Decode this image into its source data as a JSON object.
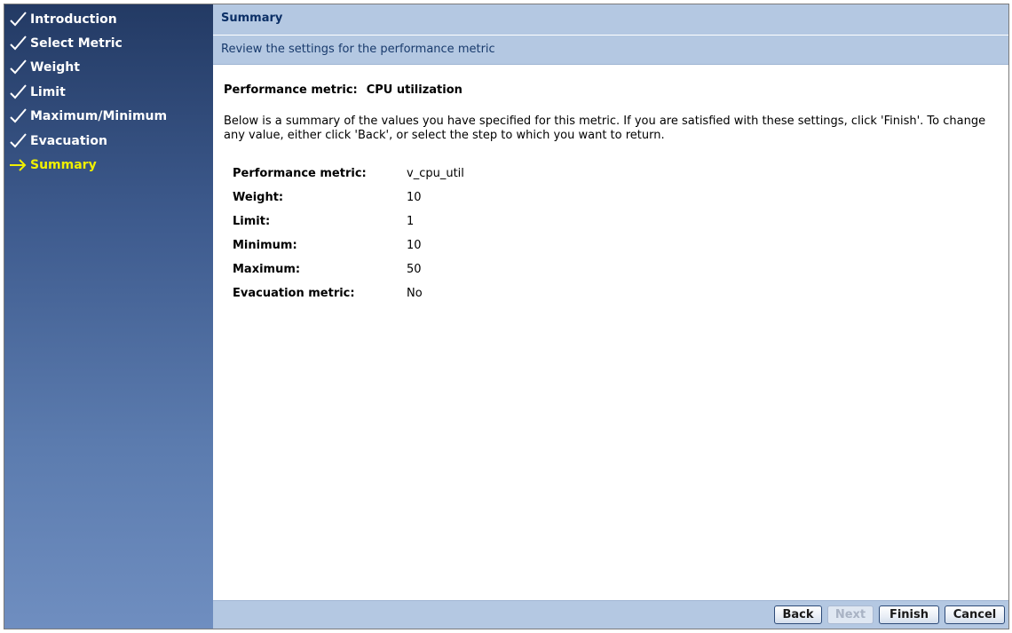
{
  "wizard": {
    "steps": [
      {
        "label": "Introduction",
        "status": "completed",
        "icon": "checkmark-icon"
      },
      {
        "label": "Select Metric",
        "status": "completed",
        "icon": "checkmark-icon"
      },
      {
        "label": "Weight",
        "status": "completed",
        "icon": "checkmark-icon"
      },
      {
        "label": "Limit",
        "status": "completed",
        "icon": "checkmark-icon"
      },
      {
        "label": "Maximum/Minimum",
        "status": "completed",
        "icon": "checkmark-icon"
      },
      {
        "label": "Evacuation",
        "status": "completed",
        "icon": "checkmark-icon"
      },
      {
        "label": "Summary",
        "status": "current",
        "icon": "arrow-right-icon"
      }
    ]
  },
  "header": {
    "title": "Summary",
    "subtitle": "Review the settings for the performance metric"
  },
  "content": {
    "metric_label": "Performance metric:",
    "metric_value": "CPU utilization",
    "description": "Below is a summary of the values you have specified for this metric. If you are satisfied with these settings, click 'Finish'. To change any value, either click 'Back', or select the step to which you want to return.",
    "summary": [
      {
        "label": "Performance metric:",
        "value": "v_cpu_util"
      },
      {
        "label": "Weight:",
        "value": "10"
      },
      {
        "label": "Limit:",
        "value": "1"
      },
      {
        "label": "Minimum:",
        "value": "10"
      },
      {
        "label": "Maximum:",
        "value": "50"
      },
      {
        "label": "Evacuation metric:",
        "value": "No"
      }
    ]
  },
  "buttons": {
    "back": "Back",
    "next": "Next",
    "finish": "Finish",
    "cancel": "Cancel"
  },
  "colors": {
    "sidebar_top": "#233a64",
    "sidebar_bottom": "#6f8ec0",
    "header_bg": "#b4c8e2",
    "current_step": "#f0f000"
  }
}
